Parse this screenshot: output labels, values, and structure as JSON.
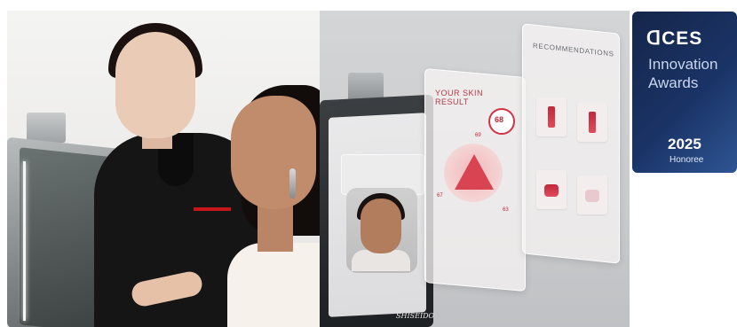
{
  "badge": {
    "ces": "ᗡCES",
    "line1": "Innovation",
    "line2": "Awards",
    "year": "2025",
    "honoree": "Honoree",
    "background": "#1a3366"
  },
  "device": {
    "brand": "SHISEIDO",
    "skin_title": "YOUR SKIN RESULT",
    "score": "68",
    "score_small": "69",
    "side_left": "67",
    "side_right": "63",
    "recommendations_title": "RECOMMENDATIONS",
    "accent": "#c0283b"
  }
}
